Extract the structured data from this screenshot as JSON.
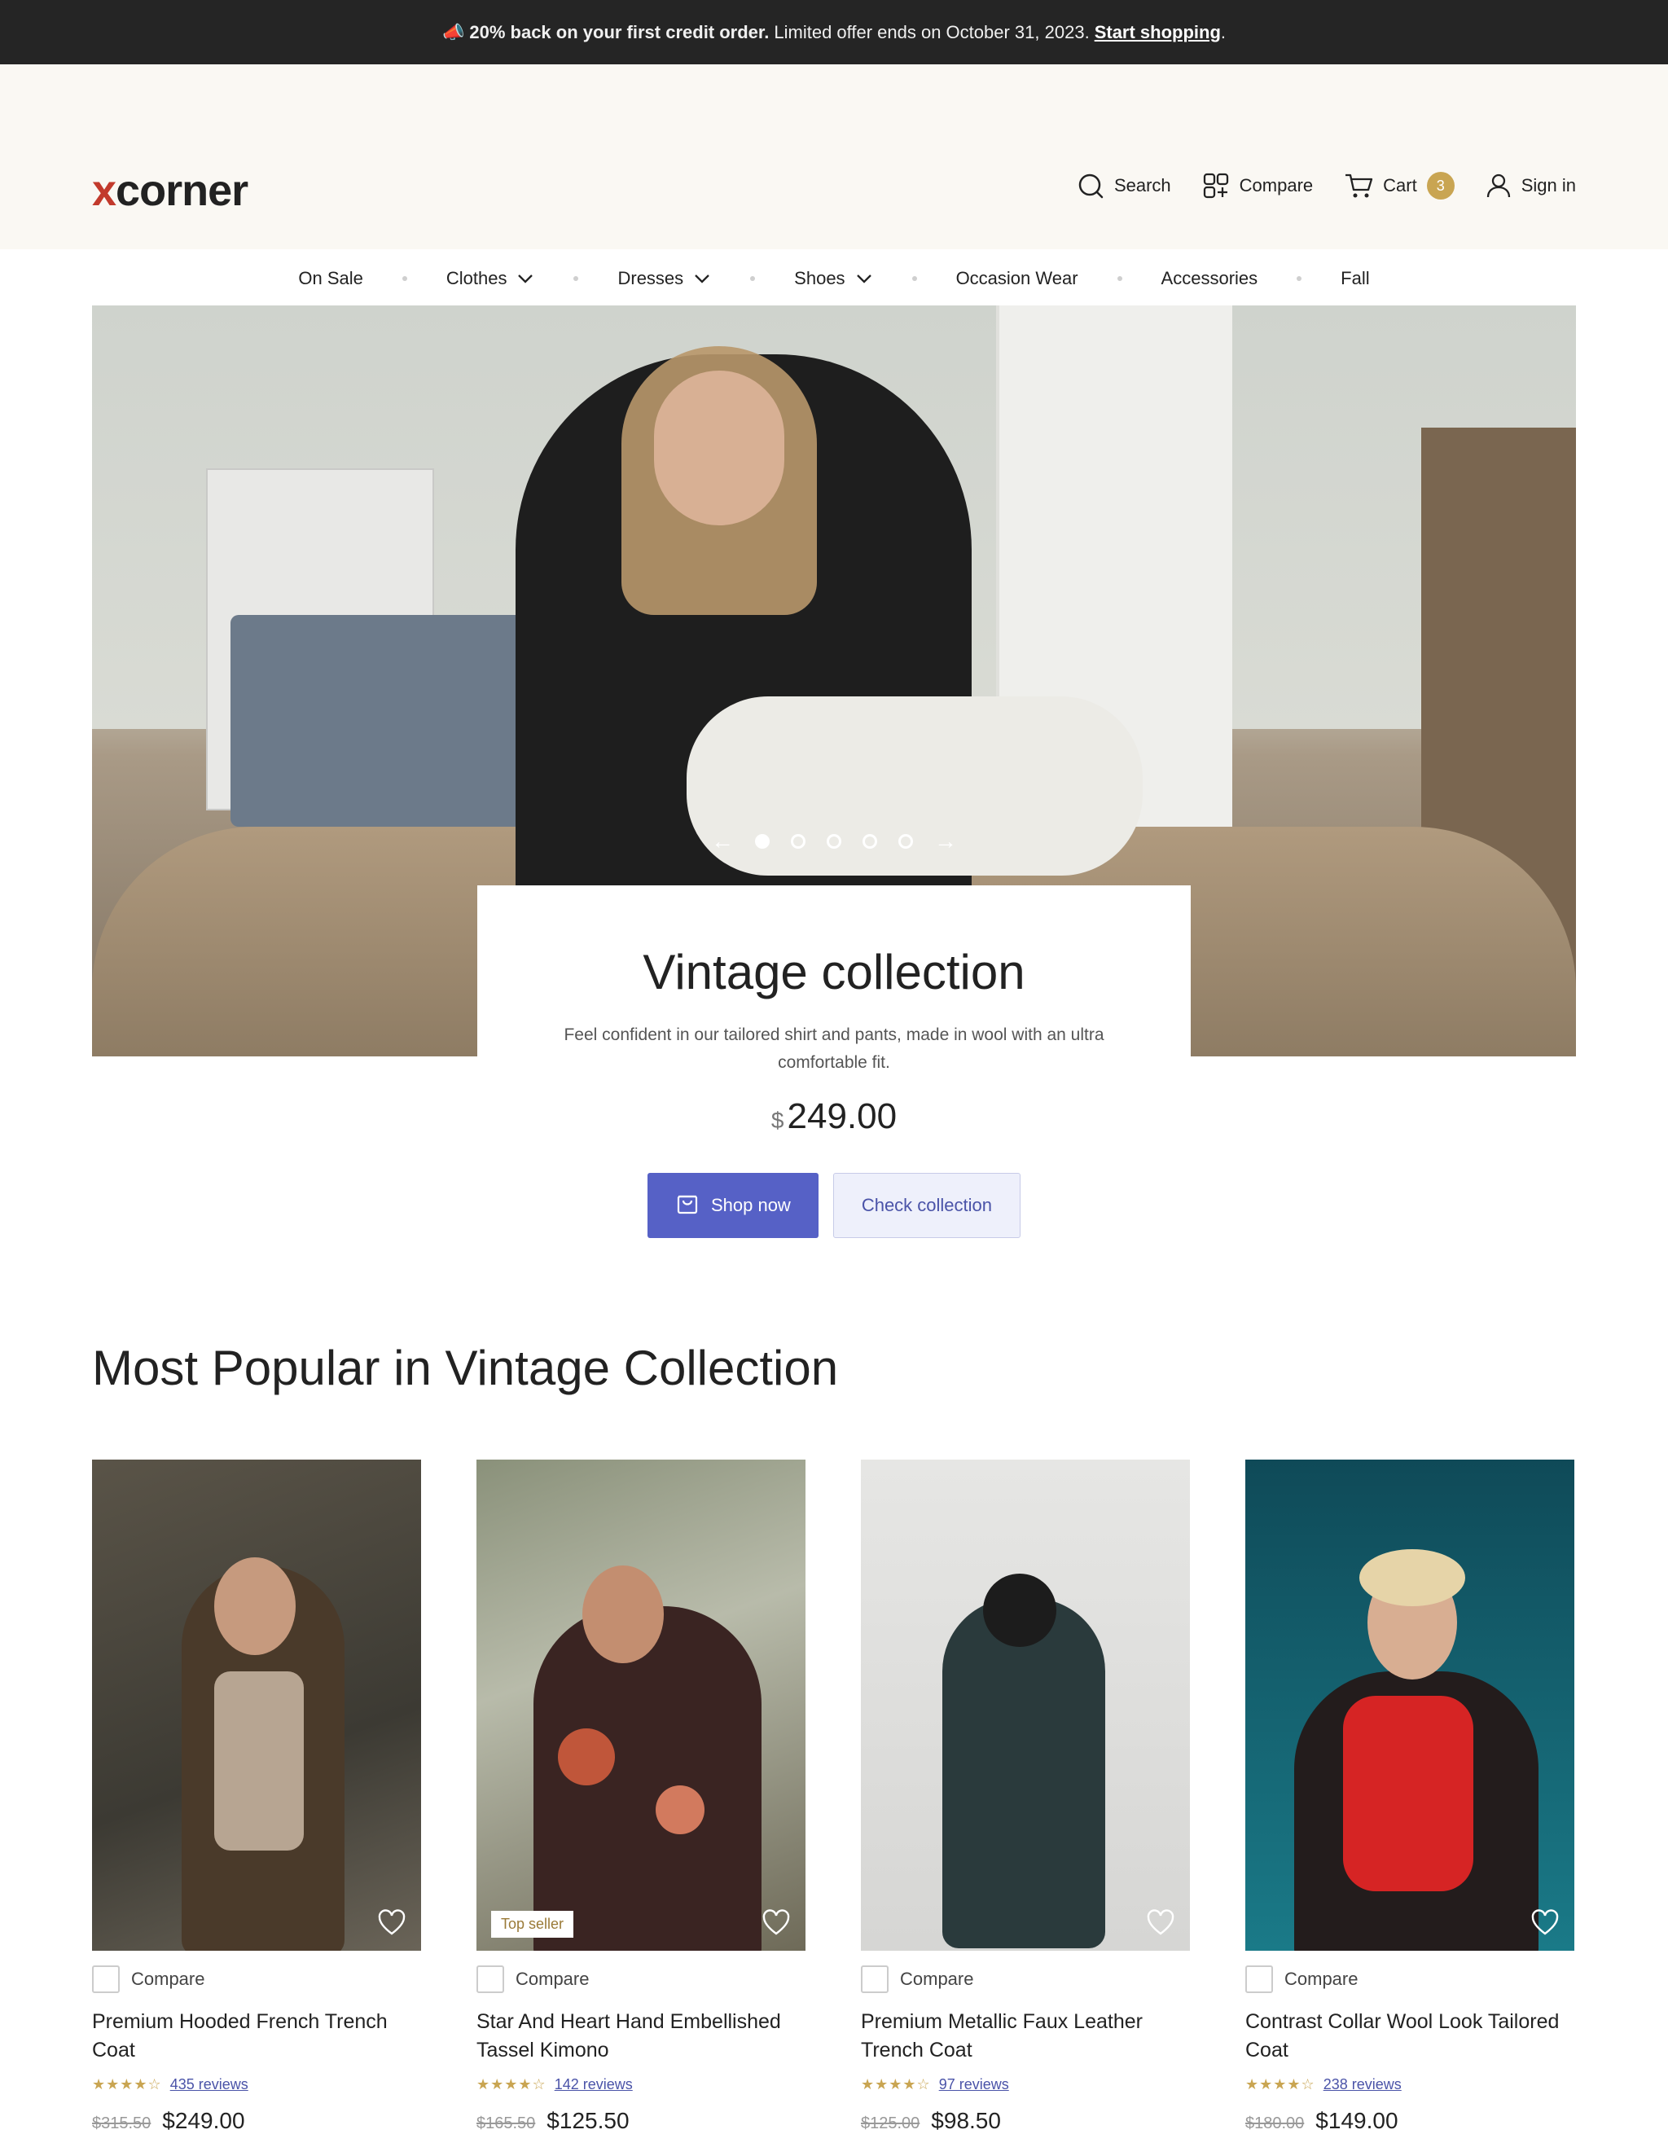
{
  "announcement": {
    "emoji": "📣",
    "bold_text": "20% back on your first credit order.",
    "text": "Limited offer ends on October 31, 2023.",
    "link": "Start shopping",
    "trailing": "."
  },
  "brand": {
    "logo_x": "x",
    "logo_rest": "corner",
    "accent": "#c23a2c"
  },
  "header_actions": {
    "search": "Search",
    "compare": "Compare",
    "cart": "Cart",
    "cart_count": "3",
    "sign_in": "Sign in"
  },
  "nav": [
    {
      "label": "On Sale",
      "has_dropdown": false
    },
    {
      "label": "Clothes",
      "has_dropdown": true
    },
    {
      "label": "Dresses",
      "has_dropdown": true
    },
    {
      "label": "Shoes",
      "has_dropdown": true
    },
    {
      "label": "Occasion Wear",
      "has_dropdown": false
    },
    {
      "label": "Accessories",
      "has_dropdown": false
    },
    {
      "label": "Fall",
      "has_dropdown": false
    }
  ],
  "hero": {
    "slides": 5,
    "active_slide": 1,
    "title": "Vintage collection",
    "description": "Feel confident in our tailored shirt and pants, made in wool with an ultra comfortable fit.",
    "currency": "$",
    "price": "249.00",
    "primary_button": "Shop now",
    "secondary_button": "Check collection"
  },
  "section": {
    "title": "Most Popular in Vintage Collection"
  },
  "compare_label": "Compare",
  "products": [
    {
      "name": "Premium Hooded French Trench Coat",
      "reviews": "435 reviews",
      "rating": 4,
      "old_price": "$315.50",
      "price": "$249.00",
      "tag": ""
    },
    {
      "name": "Star And Heart Hand Embellished Tassel Kimono",
      "reviews": "142 reviews",
      "rating": 4,
      "old_price": "$165.50",
      "price": "$125.50",
      "tag": "Top seller"
    },
    {
      "name": "Premium Metallic Faux Leather Trench Coat",
      "reviews": "97 reviews",
      "rating": 4,
      "old_price": "$125.00",
      "price": "$98.50",
      "tag": ""
    },
    {
      "name": "Contrast Collar Wool Look Tailored Coat",
      "reviews": "238 reviews",
      "rating": 4,
      "old_price": "$180.00",
      "price": "$149.00",
      "tag": ""
    }
  ],
  "colors": {
    "primary": "#5661c6",
    "gold": "#c9a552",
    "header_bg": "#faf8f3"
  }
}
